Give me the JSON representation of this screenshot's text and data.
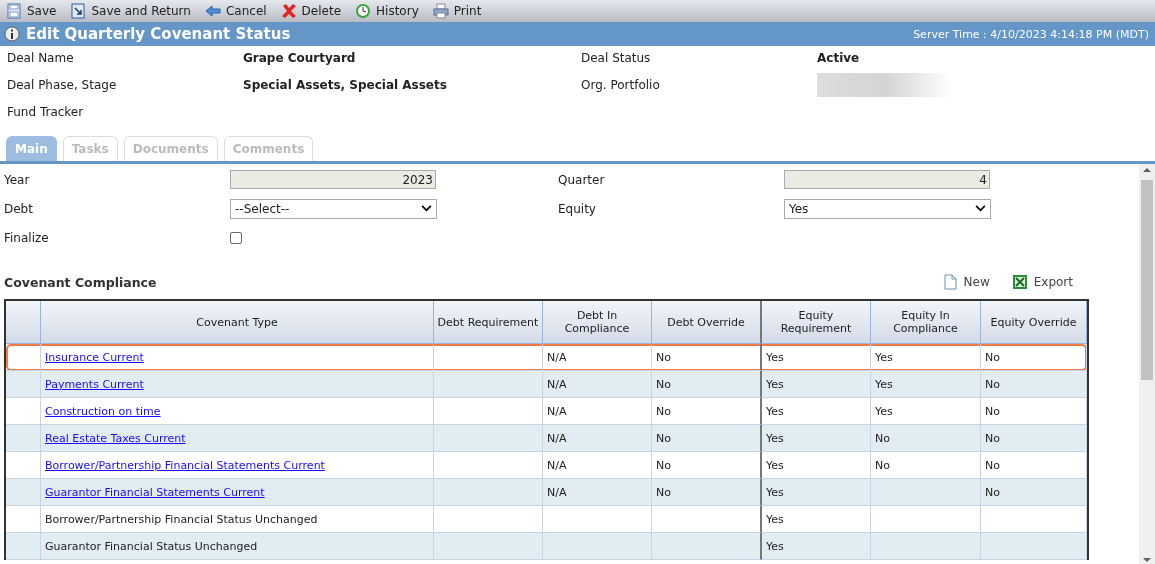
{
  "toolbar": [
    {
      "label": "Save",
      "kind": "save"
    },
    {
      "label": "Save and Return",
      "kind": "save_return"
    },
    {
      "label": "Cancel",
      "kind": "cancel"
    },
    {
      "label": "Delete",
      "kind": "delete"
    },
    {
      "label": "History",
      "kind": "history"
    },
    {
      "label": "Print",
      "kind": "print"
    }
  ],
  "header": {
    "title": "Edit Quarterly Covenant Status",
    "server_time": "Server Time : 4/10/2023 4:14:18 PM (MDT)"
  },
  "deal_fields": [
    {
      "label": "Deal Name",
      "value": "Grape Courtyard"
    },
    {
      "label": "Deal Status",
      "value": "Active"
    },
    {
      "label": "Deal Phase, Stage",
      "value": "Special Assets, Special Assets"
    },
    {
      "label": "Org. Portfolio",
      "redacted": true
    },
    {
      "label": "Fund Tracker"
    }
  ],
  "tabs": [
    {
      "label": "Main",
      "selected": true
    },
    {
      "label": "Tasks",
      "selected": false
    },
    {
      "label": "Documents",
      "selected": false
    },
    {
      "label": "Comments",
      "selected": false
    }
  ],
  "form": {
    "year": {
      "label": "Year",
      "value": "2023"
    },
    "quarter": {
      "label": "Quarter",
      "value": "4"
    },
    "debt": {
      "label": "Debt",
      "value": "--Select--"
    },
    "equity": {
      "label": "Equity",
      "value": "Yes"
    },
    "finalize": {
      "label": "Finalize",
      "checked": false
    }
  },
  "section": {
    "title": "Covenant Compliance",
    "actions": [
      {
        "label": "New",
        "kind": "new"
      },
      {
        "label": "Export",
        "kind": "export"
      }
    ]
  },
  "table": {
    "columns": [
      "Covenant Type",
      "Debt Requirement",
      "Debt In Compliance",
      "Debt Override",
      "Equity Requirement",
      "Equity In Compliance",
      "Equity Override"
    ],
    "rows": [
      {
        "selected": true,
        "link": true,
        "cells": [
          "Insurance Current",
          null,
          "N/A",
          "No",
          "Yes",
          "Yes",
          "No"
        ]
      },
      {
        "selected": false,
        "link": true,
        "cells": [
          "Payments Current",
          null,
          "N/A",
          "No",
          "Yes",
          "Yes",
          "No"
        ]
      },
      {
        "selected": false,
        "link": true,
        "cells": [
          "Construction on time",
          null,
          "N/A",
          "No",
          "Yes",
          "Yes",
          "No"
        ]
      },
      {
        "selected": false,
        "link": true,
        "cells": [
          "Real Estate Taxes Current",
          null,
          "N/A",
          "No",
          "Yes",
          "No",
          "No"
        ]
      },
      {
        "selected": false,
        "link": true,
        "cells": [
          "Borrower/Partnership Financial Statements Current",
          null,
          "N/A",
          "No",
          "Yes",
          "No",
          "No"
        ]
      },
      {
        "selected": false,
        "link": true,
        "cells": [
          "Guarantor Financial Statements Current",
          null,
          "N/A",
          "No",
          "Yes",
          null,
          "No"
        ]
      },
      {
        "selected": false,
        "link": false,
        "cells": [
          "Borrower/Partnership Financial Status Unchanged",
          null,
          null,
          null,
          "Yes",
          null,
          null
        ]
      },
      {
        "selected": false,
        "link": false,
        "cells": [
          "Guarantor Financial Status Unchanged",
          null,
          null,
          null,
          "Yes",
          null,
          null
        ]
      }
    ]
  }
}
